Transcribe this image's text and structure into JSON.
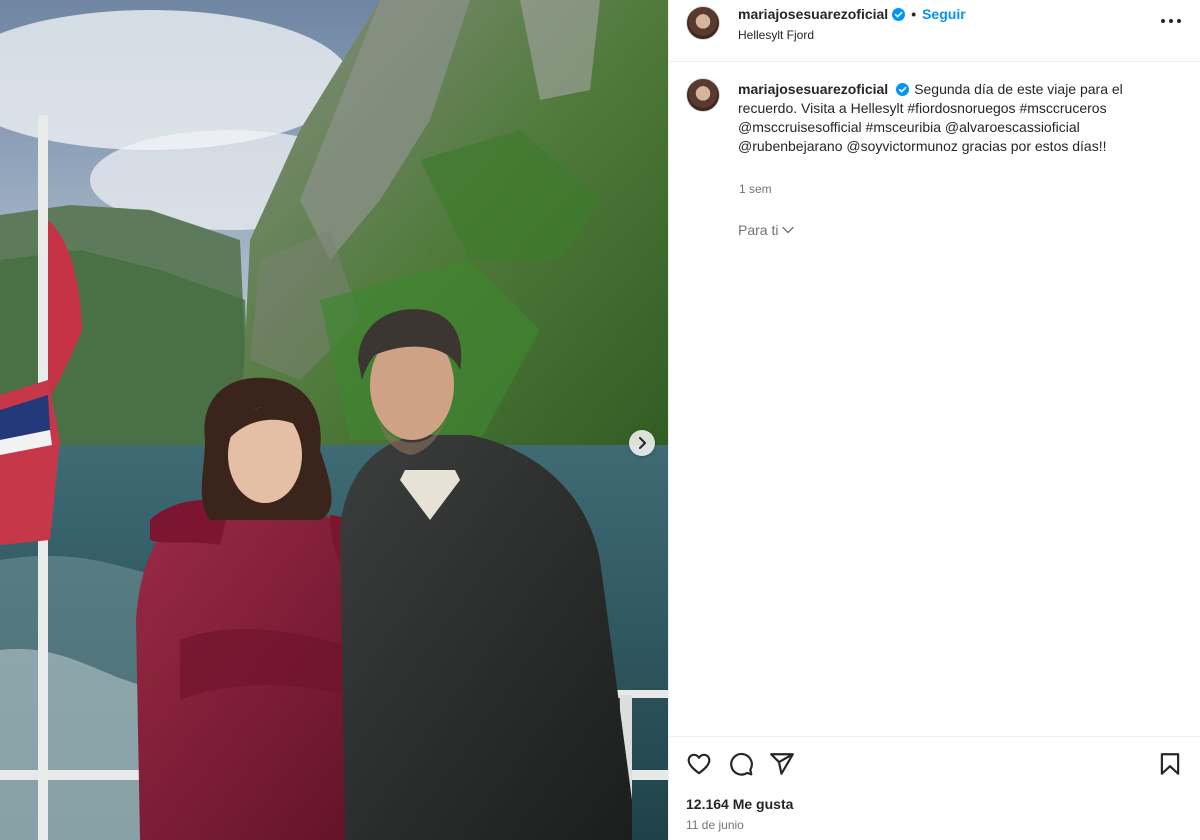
{
  "post": {
    "username": "mariajosesuarezoficial",
    "follow_label": "Seguir",
    "separator": "•",
    "location": "Hellesylt Fjord",
    "caption": "Segunda día de este viaje para el recuerdo. Visita a Hellesylt #fiordosnoruegos #msccruceros @msccruisesofficial #msceuribia @alvaroescassioficial @rubenbejarano @soyvictormunoz gracias por estos días!!",
    "caption_time": "1 sem",
    "translate_label": "Para ti",
    "likes": "12.164 Me gusta",
    "date": "11 de junio"
  },
  "icons": {
    "verified": "verified-badge-icon",
    "more": "more-options-icon",
    "like": "heart-icon",
    "comment": "comment-icon",
    "share": "share-icon",
    "save": "bookmark-icon",
    "next": "chevron-right-icon",
    "translate": "chevron-down-icon"
  },
  "colors": {
    "accent": "#0095f6",
    "text": "#262626",
    "muted": "#737373",
    "border": "#efefef"
  }
}
